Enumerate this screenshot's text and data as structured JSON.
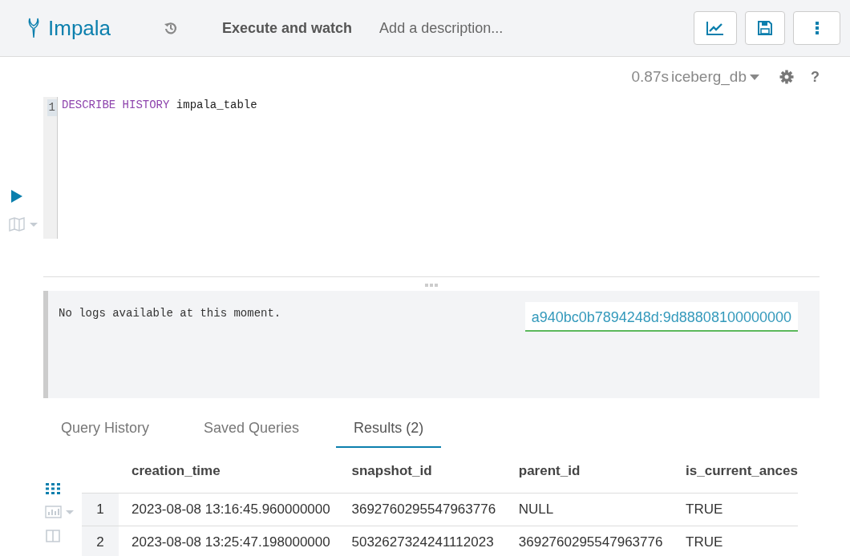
{
  "header": {
    "app_name": "Impala",
    "title": "Execute and watch",
    "description_placeholder": "Add a description..."
  },
  "editor_status": {
    "duration": "0.87s",
    "database": "iceberg_db",
    "help": "?"
  },
  "editor": {
    "lines": [
      {
        "number": "1",
        "tokens": [
          {
            "kind": "keyword",
            "text": "DESCRIBE HISTORY"
          },
          {
            "kind": "plain",
            "text": " impala_table"
          }
        ]
      }
    ]
  },
  "log_panel": {
    "message": "No logs available at this moment.",
    "query_id": "a940bc0b7894248d:9d88808100000000"
  },
  "tabs": [
    {
      "label": "Query History",
      "selected": false
    },
    {
      "label": "Saved Queries",
      "selected": false
    },
    {
      "label": "Results (2)",
      "selected": true
    }
  ],
  "table": {
    "columns": [
      "creation_time",
      "snapshot_id",
      "parent_id",
      "is_current_ances"
    ],
    "rows": [
      {
        "number": "1",
        "cells": [
          "2023-08-08 13:16:45.960000000",
          "3692760295547963776",
          "NULL",
          "TRUE"
        ]
      },
      {
        "number": "2",
        "cells": [
          "2023-08-08 13:25:47.198000000",
          "5032627324241112023",
          "3692760295547963776",
          "TRUE"
        ]
      }
    ]
  }
}
